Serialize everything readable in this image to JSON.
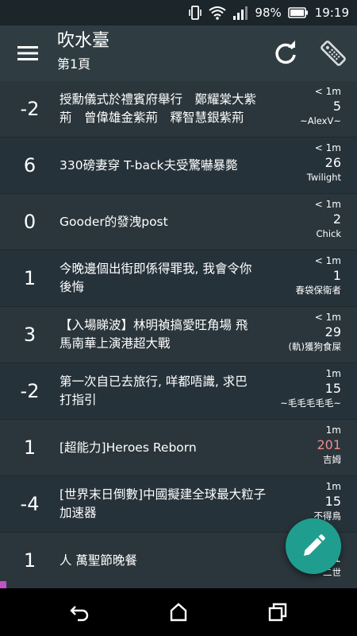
{
  "status": {
    "battery": "98%",
    "time": "19:19"
  },
  "header": {
    "title": "吹水臺",
    "subtitle": "第1頁"
  },
  "topics": [
    {
      "score": "-2",
      "lines": [
        "授勳儀式於禮賓府舉行　鄭耀棠大紫",
        "荊　曾偉雄金紫荊　釋智慧銀紫荊"
      ],
      "time": "< 1m",
      "count": "5",
      "author": "~AlexV~"
    },
    {
      "score": "6",
      "lines": [
        "330磅妻穿 T-back夫受驚嚇暴斃"
      ],
      "time": "< 1m",
      "count": "26",
      "author": "Twilight"
    },
    {
      "score": "0",
      "lines": [
        "Gooder的發洩post"
      ],
      "time": "< 1m",
      "count": "2",
      "author": "Chick"
    },
    {
      "score": "1",
      "lines": [
        "今晚邊個出街即係得罪我, 我會令你",
        "後悔"
      ],
      "time": "< 1m",
      "count": "1",
      "author": "春袋保衛者"
    },
    {
      "score": "3",
      "lines": [
        "【入場睇波】林明禎搞愛旺角場 飛",
        "馬南華上演港超大戰"
      ],
      "time": "< 1m",
      "count": "29",
      "author": "(軌)獲狗食屎"
    },
    {
      "score": "-2",
      "lines": [
        "第一次自已去旅行, 咩都唔識, 求巴",
        "打指引"
      ],
      "time": "1m",
      "count": "15",
      "author": "~毛毛毛毛毛~"
    },
    {
      "score": "1",
      "lines": [
        "[超能力]Heroes Reborn"
      ],
      "time": "1m",
      "count": "201",
      "author": "吉姆",
      "hot": true
    },
    {
      "score": "-4",
      "lines": [
        "[世界末日倒數]中國擬建全球最大粒子",
        "加速器"
      ],
      "time": "1m",
      "count": "15",
      "author": "不得鳥"
    },
    {
      "score": "1",
      "lines": [
        "人 萬聖節晚餐"
      ],
      "time": "1m",
      "count": "1",
      "author": "二世"
    }
  ],
  "colors": {
    "accent": "#1f9e8f",
    "hot_count": "#f08a8a",
    "appbar": "#2f3d43"
  },
  "icons": {
    "menu": "menu-icon",
    "refresh": "refresh-icon",
    "remote": "remote-icon",
    "compose": "pencil-icon"
  }
}
